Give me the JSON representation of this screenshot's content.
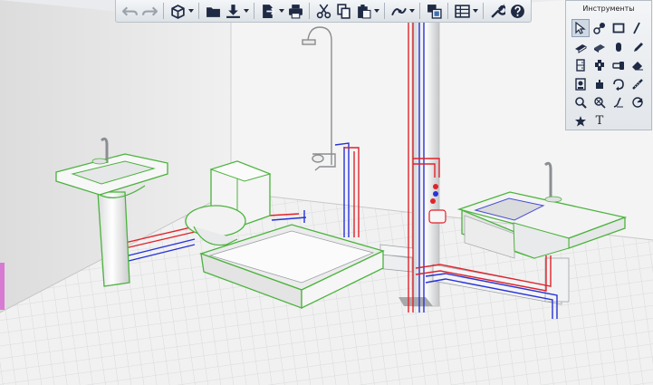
{
  "tool_panel": {
    "title": "Инструменты",
    "text_tool_glyph": "T",
    "tools": [
      "select-arrow-icon",
      "nodes-icon",
      "rectangle-icon",
      "line-icon",
      "wall-panel-icon",
      "floor-icon",
      "cylinder-icon",
      "pencil-icon",
      "cabinet-icon",
      "faucet-icon",
      "pipe-tool-icon",
      "eraser-icon",
      "mirror-icon",
      "valve-icon",
      "rotate-icon",
      "measure-icon",
      "zoom-icon",
      "lamp-icon",
      "slope-icon",
      "section-icon",
      "star-icon"
    ]
  },
  "toolbar": {
    "buttons": [
      "undo-icon",
      "redo-icon",
      "box-view-icon",
      "folder-icon",
      "download-icon",
      "export-icon",
      "print-icon",
      "cut-icon",
      "copy-icon",
      "paste-icon",
      "pipe-route-icon",
      "layers-icon",
      "table-icon",
      "wrench-icon",
      "help-icon"
    ]
  },
  "colors": {
    "selection": "#4bb33d",
    "hot_pipe": "#e0232a",
    "cold_pipe": "#2732d8",
    "wall": "#f3f3f3",
    "floor_grid": "#d9d9d9",
    "toolbar_icon": "#1f2a44",
    "sink_basin": "#4a4fd6"
  }
}
